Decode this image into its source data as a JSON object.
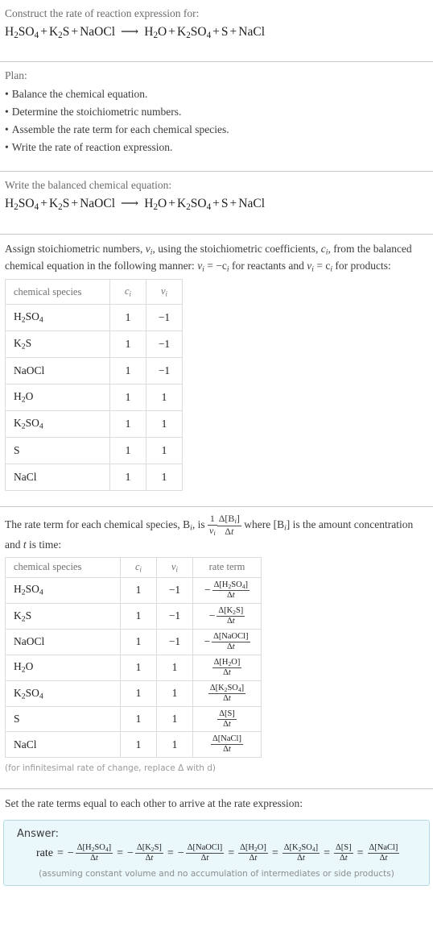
{
  "header": {
    "prompt": "Construct the rate of reaction expression for:",
    "equation": {
      "reactants": [
        {
          "formula": "H2SO4",
          "parts": [
            [
              "H",
              ""
            ],
            [
              "2",
              "sub"
            ],
            [
              "SO",
              ""
            ],
            [
              "4",
              "sub"
            ]
          ]
        },
        {
          "formula": "K2S",
          "parts": [
            [
              "K",
              ""
            ],
            [
              "2",
              "sub"
            ],
            [
              "S",
              ""
            ]
          ]
        },
        {
          "formula": "NaOCl",
          "parts": [
            [
              "NaOCl",
              ""
            ]
          ]
        }
      ],
      "arrow": "⟶",
      "products": [
        {
          "formula": "H2O",
          "parts": [
            [
              "H",
              ""
            ],
            [
              "2",
              "sub"
            ],
            [
              "O",
              ""
            ]
          ]
        },
        {
          "formula": "K2SO4",
          "parts": [
            [
              "K",
              ""
            ],
            [
              "2",
              "sub"
            ],
            [
              "SO",
              ""
            ],
            [
              "4",
              "sub"
            ]
          ]
        },
        {
          "formula": "S",
          "parts": [
            [
              "S",
              ""
            ]
          ]
        },
        {
          "formula": "NaCl",
          "parts": [
            [
              "NaCl",
              ""
            ]
          ]
        }
      ]
    }
  },
  "plan": {
    "title": "Plan:",
    "bullet": "•",
    "steps": [
      "Balance the chemical equation.",
      "Determine the stoichiometric numbers.",
      "Assemble the rate term for each chemical species.",
      "Write the rate of reaction expression."
    ]
  },
  "balanced": {
    "title": "Write the balanced chemical equation:"
  },
  "stoich_intro": {
    "line1_a": "Assign stoichiometric numbers, ",
    "line1_v": "ν",
    "line1_i": "i",
    "line1_b": ", using the stoichiometric coefficients, ",
    "line1_c": "c",
    "line1_d": ", from the balanced chemical equation in the following manner: ",
    "eq1": "ν",
    "eq1_eq": " = −c",
    "eq1_tail": " for reactants and ",
    "eq2": "ν",
    "eq2_eq": " = c",
    "eq2_tail": " for products:"
  },
  "species_table": {
    "headers": {
      "species": "chemical species",
      "c": "c",
      "v": "ν",
      "sub_i": "i",
      "rate": "rate term"
    },
    "rows": [
      {
        "species": "H2SO4",
        "c": "1",
        "v": "−1"
      },
      {
        "species": "K2S",
        "c": "1",
        "v": "−1"
      },
      {
        "species": "NaOCl",
        "c": "1",
        "v": "−1"
      },
      {
        "species": "H2O",
        "c": "1",
        "v": "1"
      },
      {
        "species": "K2SO4",
        "c": "1",
        "v": "1"
      },
      {
        "species": "S",
        "c": "1",
        "v": "1"
      },
      {
        "species": "NaCl",
        "c": "1",
        "v": "1"
      }
    ]
  },
  "rate_intro": {
    "part1": "The rate term for each chemical species, B",
    "sub_i": "i",
    "part2": ", is ",
    "frac_num1": "1",
    "frac_den1": "ν",
    "frac_num2": "Δ[B",
    "frac_num2b": "]",
    "frac_den2": "Δt",
    "part3": " where [B",
    "part4": "] is the amount concentration and ",
    "part5_t": "t",
    "part6": " is time:"
  },
  "rate_table": {
    "rows": [
      {
        "species": "H2SO4",
        "c": "1",
        "v": "−1",
        "sign": "−",
        "num": "Δ[H2SO4]",
        "den": "Δt"
      },
      {
        "species": "K2S",
        "c": "1",
        "v": "−1",
        "sign": "−",
        "num": "Δ[K2S]",
        "den": "Δt"
      },
      {
        "species": "NaOCl",
        "c": "1",
        "v": "−1",
        "sign": "−",
        "num": "Δ[NaOCl]",
        "den": "Δt"
      },
      {
        "species": "H2O",
        "c": "1",
        "v": "1",
        "sign": "",
        "num": "Δ[H2O]",
        "den": "Δt"
      },
      {
        "species": "K2SO4",
        "c": "1",
        "v": "1",
        "sign": "",
        "num": "Δ[K2SO4]",
        "den": "Δt"
      },
      {
        "species": "S",
        "c": "1",
        "v": "1",
        "sign": "",
        "num": "Δ[S]",
        "den": "Δt"
      },
      {
        "species": "NaCl",
        "c": "1",
        "v": "1",
        "sign": "",
        "num": "Δ[NaCl]",
        "den": "Δt"
      }
    ],
    "footnote": "(for infinitesimal rate of change, replace Δ with d)"
  },
  "final": {
    "lead": "Set the rate terms equal to each other to arrive at the rate expression:",
    "answer_label": "Answer:",
    "rate_word": "rate",
    "equals": "=",
    "note": "(assuming constant volume and no accumulation of intermediates or side products)"
  },
  "colors": {
    "answer_bg": "#eaf7fb",
    "answer_border": "#b5dbe6",
    "divider": "#c9c9c9",
    "muted_text": "#6b6b6b",
    "body_text": "#3b3b3b"
  }
}
